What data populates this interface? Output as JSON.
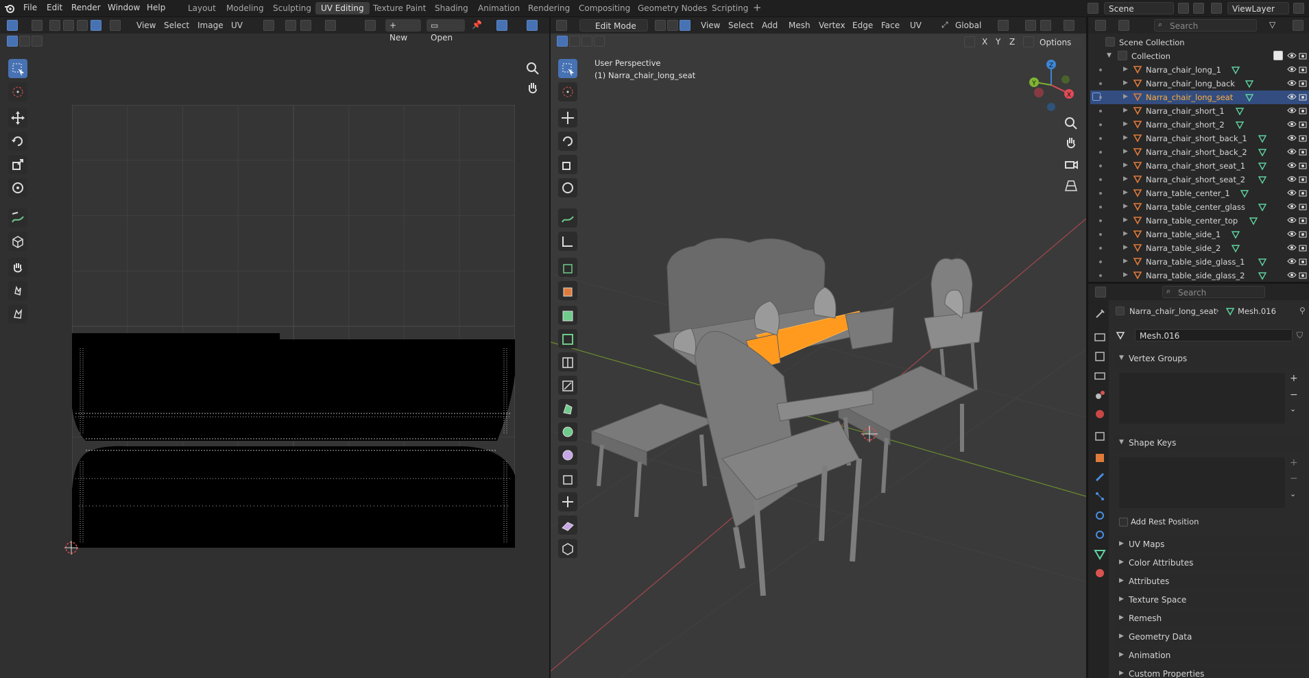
{
  "topbar": {
    "menus": [
      "File",
      "Edit",
      "Render",
      "Window",
      "Help"
    ],
    "workspaces": [
      "Layout",
      "Modeling",
      "Sculpting",
      "UV Editing",
      "Texture Paint",
      "Shading",
      "Animation",
      "Rendering",
      "Compositing",
      "Geometry Nodes",
      "Scripting"
    ],
    "active_workspace": "UV Editing",
    "scene": "Scene",
    "view_layer": "ViewLayer"
  },
  "uv_editor": {
    "menus": [
      "View",
      "Select",
      "Image",
      "UV"
    ],
    "new_label": "New",
    "open_label": "Open"
  },
  "viewport": {
    "mode": "Edit Mode",
    "menus": [
      "View",
      "Select",
      "Add",
      "Mesh",
      "Vertex",
      "Edge",
      "Face",
      "UV"
    ],
    "orientation": "Global",
    "options_label": "Options",
    "overlay_line1": "User Perspective",
    "overlay_line2": "(1) Narra_chair_long_seat",
    "axes": [
      "X",
      "Y",
      "Z"
    ],
    "gizmo": {
      "x": "X",
      "y": "Y",
      "z": "Z"
    }
  },
  "outliner": {
    "search_placeholder": "Search",
    "scene_collection": "Scene Collection",
    "collection": "Collection",
    "items": [
      {
        "name": "Narra_chair_long_1",
        "selected": false
      },
      {
        "name": "Narra_chair_long_back",
        "selected": false
      },
      {
        "name": "Narra_chair_long_seat",
        "selected": true
      },
      {
        "name": "Narra_chair_short_1",
        "selected": false
      },
      {
        "name": "Narra_chair_short_2",
        "selected": false
      },
      {
        "name": "Narra_chair_short_back_1",
        "selected": false
      },
      {
        "name": "Narra_chair_short_back_2",
        "selected": false
      },
      {
        "name": "Narra_chair_short_seat_1",
        "selected": false
      },
      {
        "name": "Narra_chair_short_seat_2",
        "selected": false
      },
      {
        "name": "Narra_table_center_1",
        "selected": false
      },
      {
        "name": "Narra_table_center_glass",
        "selected": false
      },
      {
        "name": "Narra_table_center_top",
        "selected": false
      },
      {
        "name": "Narra_table_side_1",
        "selected": false
      },
      {
        "name": "Narra_table_side_2",
        "selected": false
      },
      {
        "name": "Narra_table_side_glass_1",
        "selected": false
      },
      {
        "name": "Narra_table_side_glass_2",
        "selected": false
      }
    ]
  },
  "properties": {
    "search_placeholder": "Search",
    "breadcrumb_object": "Narra_chair_long_seat",
    "breadcrumb_mesh": "Mesh.016",
    "mesh_name": "Mesh.016",
    "panels_open": [
      "Vertex Groups",
      "Shape Keys"
    ],
    "add_rest_position": "Add Rest Position",
    "panels_closed": [
      "UV Maps",
      "Color Attributes",
      "Attributes",
      "Texture Space",
      "Remesh",
      "Geometry Data",
      "Animation",
      "Custom Properties"
    ]
  },
  "colors": {
    "accent": "#4772b3",
    "selection": "#ffa028",
    "axis_x": "#e04a57",
    "axis_y": "#7fb332",
    "axis_z": "#3c86d6"
  }
}
